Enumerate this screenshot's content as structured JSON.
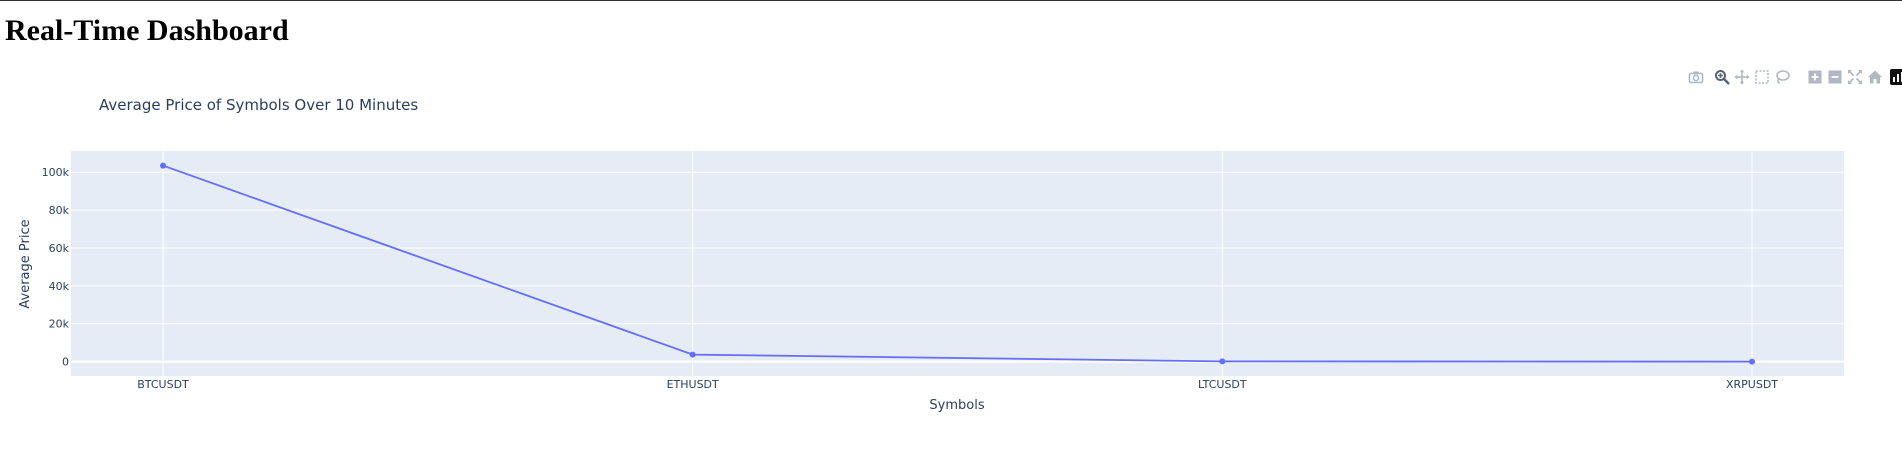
{
  "page": {
    "title": "Real-Time Dashboard"
  },
  "modebar": {
    "icons": [
      "camera-icon",
      "zoom-icon",
      "pan-icon",
      "box-select-icon",
      "lasso-select-icon",
      "zoom-in-icon",
      "zoom-out-icon",
      "autoscale-icon",
      "reset-axes-icon",
      "plotly-logo-icon"
    ]
  },
  "chart_data": {
    "type": "line",
    "title": "Average Price of Symbols Over 10 Minutes",
    "xlabel": "Symbols",
    "ylabel": "Average Price",
    "categories": [
      "BTCUSDT",
      "ETHUSDT",
      "LTCUSDT",
      "XRPUSDT"
    ],
    "series": [
      {
        "values": [
          103500,
          3700,
          130,
          2.3
        ],
        "color": "#636efa",
        "mode": "lines+markers"
      }
    ],
    "ylim": [
      -7600,
      111200
    ],
    "yticks": [
      0,
      20000,
      40000,
      60000,
      80000,
      100000
    ],
    "ytick_labels": [
      "0",
      "20k",
      "40k",
      "60k",
      "80k",
      "100k"
    ],
    "grid": true,
    "plot_bgcolor": "#e5ecf6",
    "gridcolor": "#ffffff"
  }
}
